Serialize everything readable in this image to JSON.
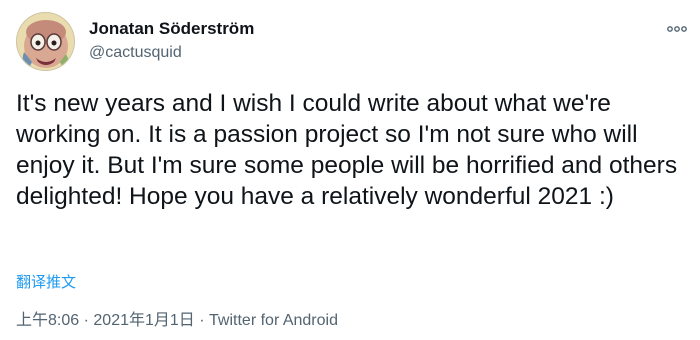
{
  "user": {
    "display_name": "Jonatan Söderström",
    "handle": "@cactusquid"
  },
  "tweet": {
    "text": "It's new years and I wish I could write about what we're working on. It is a passion project so I'm not sure who will enjoy it. But I'm sure some people will be horrified and others delighted! Hope you have a relatively wonderful 2021 :)",
    "translate_label": "翻译推文",
    "time": "上午8:06",
    "separator": "·",
    "date": "2021年1月1日",
    "source": "Twitter for Android"
  },
  "icons": {
    "more": "more-horizontal-icon",
    "avatar": "avatar-image"
  },
  "colors": {
    "link": "#1d9bf0",
    "secondary_text": "#536471",
    "primary_text": "#0f1419"
  }
}
